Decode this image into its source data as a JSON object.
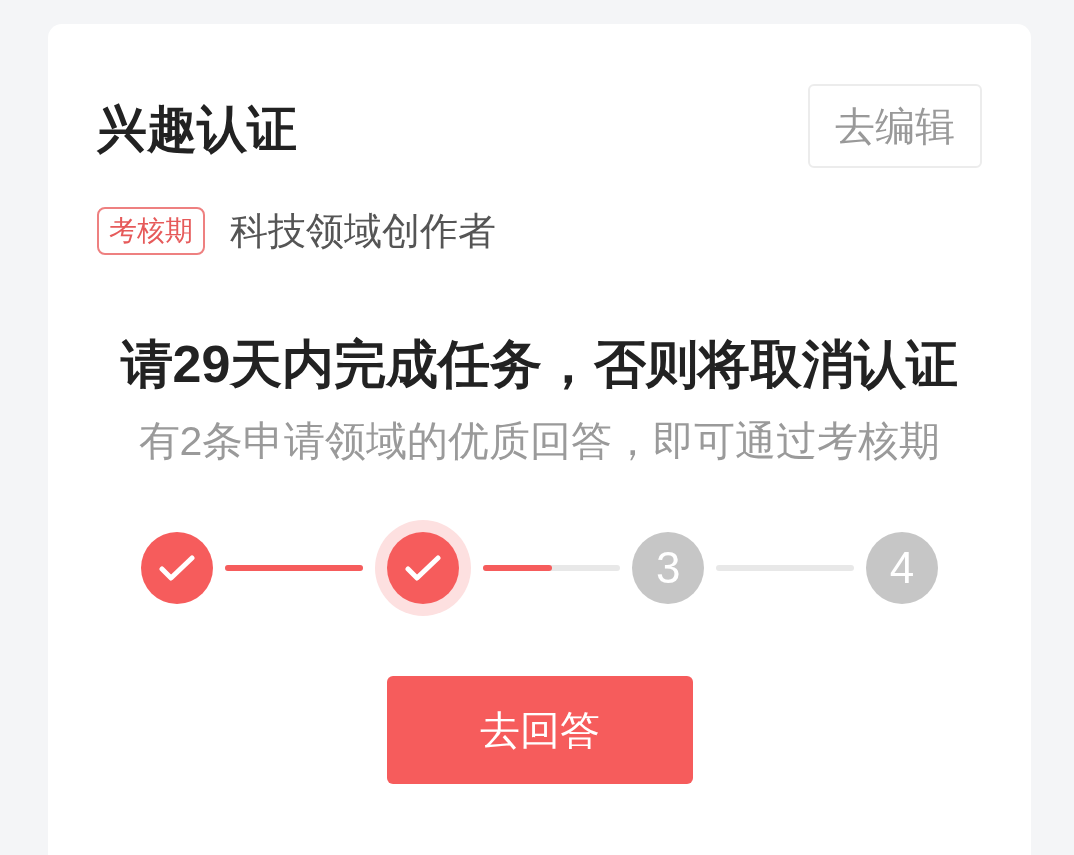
{
  "card": {
    "title": "兴趣认证",
    "edit_button": "去编辑",
    "status_tag": "考核期",
    "domain": "科技领域创作者",
    "heading": "请29天内完成任务，否则将取消认证",
    "subtitle": "有2条申请领域的优质回答，即可通过考核期",
    "steps": [
      {
        "done": true,
        "selected": false
      },
      {
        "done": true,
        "selected": true
      },
      {
        "done": false,
        "selected": false,
        "label": "3"
      },
      {
        "done": false,
        "selected": false,
        "label": "4"
      }
    ],
    "connectors": [
      {
        "level": 1
      },
      {
        "level": 0.5
      },
      {
        "level": 0
      }
    ],
    "action_button": "去回答"
  }
}
